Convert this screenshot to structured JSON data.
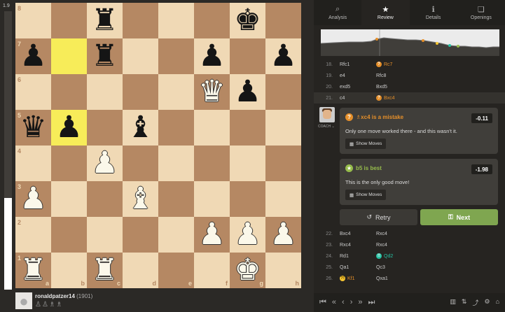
{
  "eval": {
    "label": "1.9",
    "white_fraction": 0.33
  },
  "board": {
    "files": [
      "a",
      "b",
      "c",
      "d",
      "e",
      "f",
      "g",
      "h"
    ],
    "ranks": [
      "8",
      "7",
      "6",
      "5",
      "4",
      "3",
      "2",
      "1"
    ],
    "highlight": [
      "b7",
      "b5"
    ],
    "pieces": {
      "c8": "♜b",
      "g8": "♚b",
      "a7": "♟b",
      "c7": "♜b",
      "f7": "♟b",
      "h7": "♟b",
      "f6": "♛w",
      "g6": "♟b",
      "a5": "♛b",
      "b5": "♟b",
      "d5": "♝b",
      "c4": "♟w",
      "a3": "♟w",
      "d3": "♝w",
      "f2": "♟w",
      "g2": "♟w",
      "h2": "♟w",
      "a1": "♜w",
      "c1": "♜w",
      "g1": "♚w"
    }
  },
  "player": {
    "name": "ronaldpatzer14",
    "rating": "(1901)",
    "captured": "♙♙♗♗"
  },
  "tabs": [
    {
      "icon": "⌕",
      "label": "Analysis"
    },
    {
      "icon": "★",
      "label": "Review"
    },
    {
      "icon": "ℹ",
      "label": "Details"
    },
    {
      "icon": "❏",
      "label": "Openings"
    }
  ],
  "moves_top": [
    {
      "num": "18.",
      "white": "Rfc1",
      "black": "Rc7",
      "black_mark": "?"
    },
    {
      "num": "19.",
      "white": "e4",
      "black": "Rfc8"
    },
    {
      "num": "20.",
      "white": "exd5",
      "black": "Bxd5"
    },
    {
      "num": "21.",
      "white": "c4",
      "black": "Bxc4",
      "black_mark": "?"
    }
  ],
  "coach_label": "COACH ⌄",
  "mistake_card": {
    "title": "♗xc4 is a mistake",
    "score": "-0.11",
    "text": "Only one move worked there - and this wasn't it.",
    "show_moves": "Show Moves"
  },
  "best_card": {
    "title": "b5 is best",
    "score": "-1.98",
    "text": "This is the only good move!",
    "show_moves": "Show Moves"
  },
  "buttons": {
    "retry": "Retry",
    "next": "Next"
  },
  "moves_bottom": [
    {
      "num": "22.",
      "white": "Bxc4",
      "black": "Rxc4"
    },
    {
      "num": "23.",
      "white": "Rxc4",
      "black": "Rxc4"
    },
    {
      "num": "24.",
      "white": "Rd1",
      "black": "Qd2",
      "black_mark": "!!"
    },
    {
      "num": "25.",
      "white": "Qa1",
      "black": "Qc3"
    },
    {
      "num": "26.",
      "white": "Kf1",
      "white_mark": "?!",
      "black": "Qxa1"
    }
  ],
  "colors": {
    "accent_green": "#7fa650",
    "mistake_orange": "#e58f2a",
    "brilliant_teal": "#26c2a3",
    "best_green": "#96bc4b"
  }
}
